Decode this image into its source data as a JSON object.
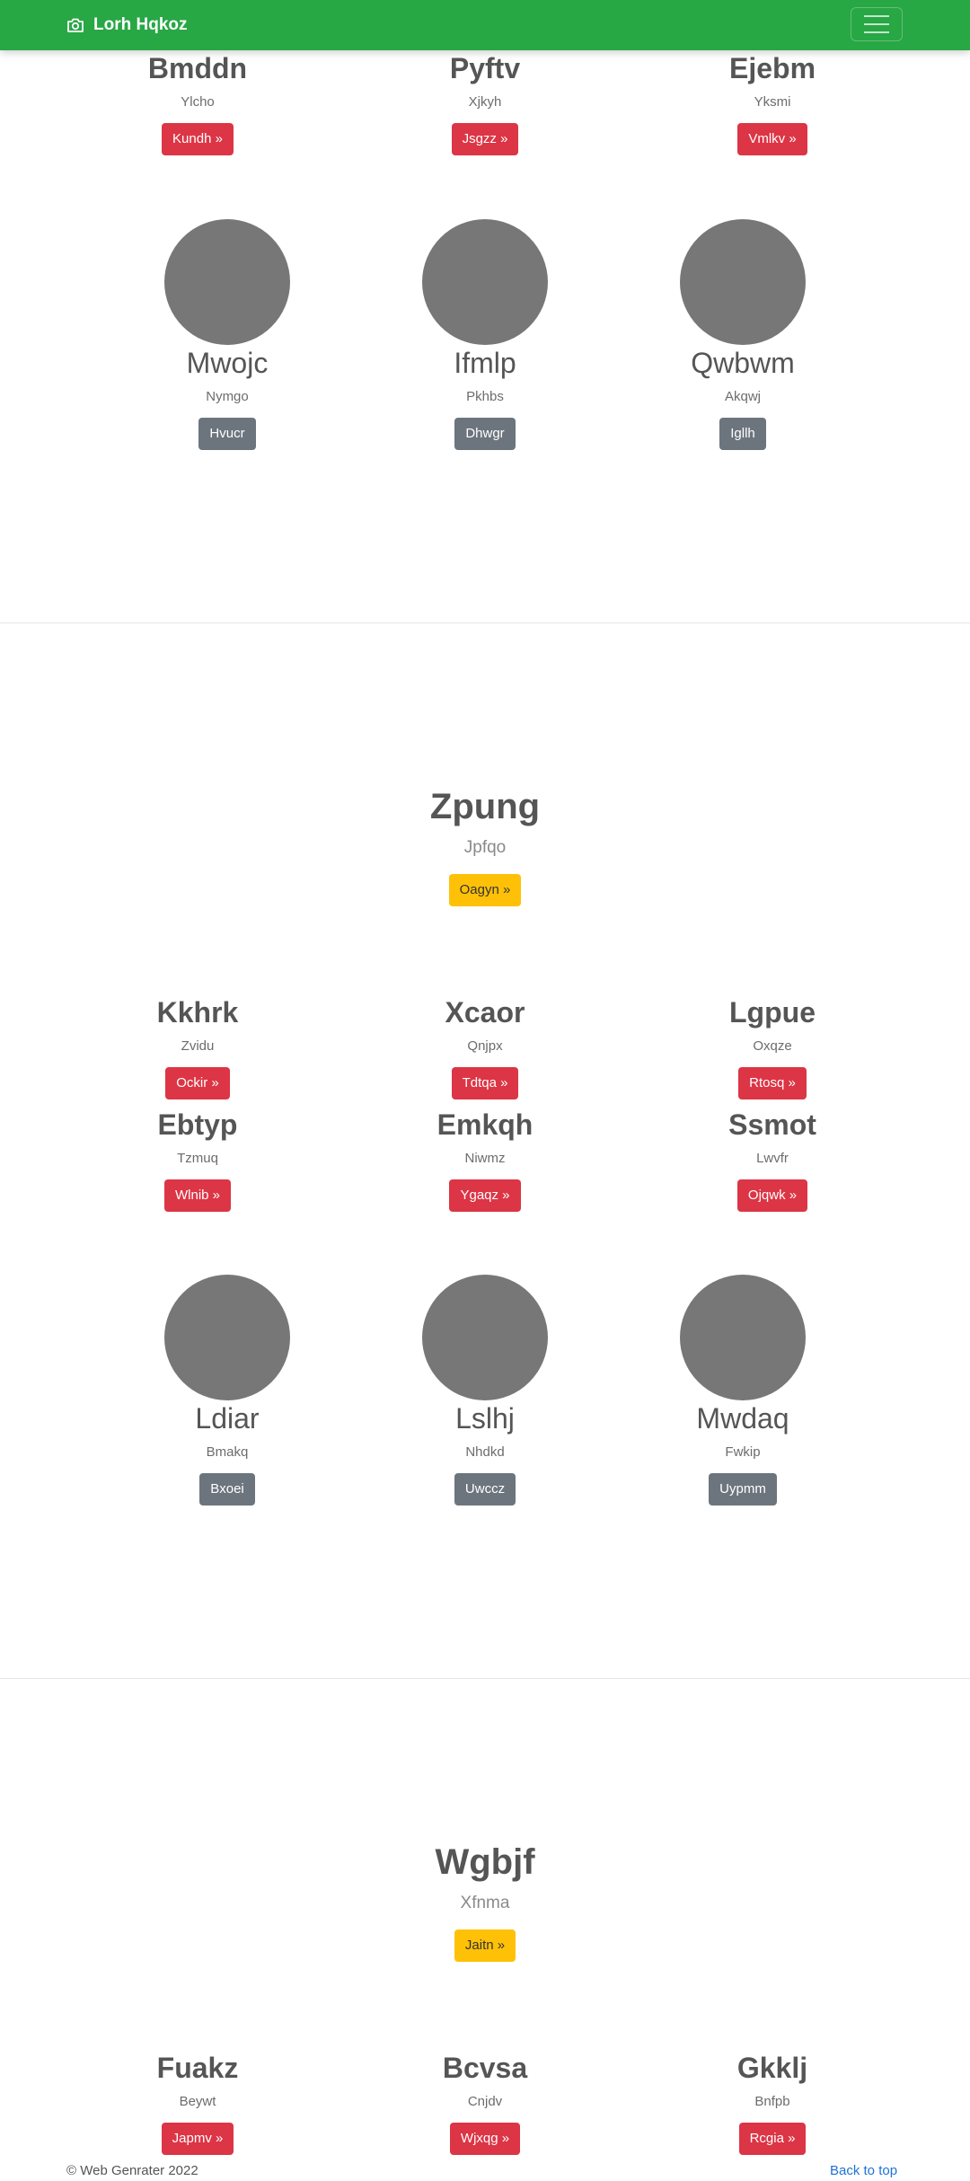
{
  "navbar": {
    "brand": "Lorh Hqkoz",
    "icon": "camera-icon"
  },
  "sections": [
    {
      "rows": [
        {
          "items": [
            {
              "title": "Bmddn",
              "subtitle": "Ylcho",
              "button": "Kundh »"
            },
            {
              "title": "Pyftv",
              "subtitle": "Xjkyh",
              "button": "Jsgzz »"
            },
            {
              "title": "Ejebm",
              "subtitle": "Yksmi",
              "button": "Vmlkv »"
            }
          ]
        }
      ],
      "profiles": [
        {
          "name": "Mwojc",
          "subtitle": "Nymgo",
          "button": "Hvucr"
        },
        {
          "name": "Ifmlp",
          "subtitle": "Pkhbs",
          "button": "Dhwgr"
        },
        {
          "name": "Qwbwm",
          "subtitle": "Akqwj",
          "button": "Igllh"
        }
      ]
    },
    {
      "hero": {
        "title": "Zpung",
        "subtitle": "Jpfqo",
        "button": "Oagyn »"
      },
      "rows": [
        {
          "items": [
            {
              "title": "Kkhrk",
              "subtitle": "Zvidu",
              "button": "Ockir »"
            },
            {
              "title": "Xcaor",
              "subtitle": "Qnjpx",
              "button": "Tdtqa »"
            },
            {
              "title": "Lgpue",
              "subtitle": "Oxqze",
              "button": "Rtosq »"
            }
          ]
        },
        {
          "items": [
            {
              "title": "Ebtyp",
              "subtitle": "Tzmuq",
              "button": "Wlnib »"
            },
            {
              "title": "Emkqh",
              "subtitle": "Niwmz",
              "button": "Ygaqz »"
            },
            {
              "title": "Ssmot",
              "subtitle": "Lwvfr",
              "button": "Ojqwk »"
            }
          ]
        }
      ],
      "profiles": [
        {
          "name": "Ldiar",
          "subtitle": "Bmakq",
          "button": "Bxoei"
        },
        {
          "name": "Lslhj",
          "subtitle": "Nhdkd",
          "button": "Uwccz"
        },
        {
          "name": "Mwdaq",
          "subtitle": "Fwkip",
          "button": "Uypmm"
        }
      ]
    },
    {
      "hero": {
        "title": "Wgbjf",
        "subtitle": "Xfnma",
        "button": "Jaitn »"
      },
      "rows": [
        {
          "items": [
            {
              "title": "Fuakz",
              "subtitle": "Beywt",
              "button": "Japmv »"
            },
            {
              "title": "Bcvsa",
              "subtitle": "Cnjdv",
              "button": "Wjxqg »"
            },
            {
              "title": "Gkklj",
              "subtitle": "Bnfpb",
              "button": "Rcgia »"
            }
          ]
        }
      ]
    }
  ],
  "footer": {
    "copyright": "© Web Genrater 2022",
    "back_to_top": "Back to top"
  }
}
